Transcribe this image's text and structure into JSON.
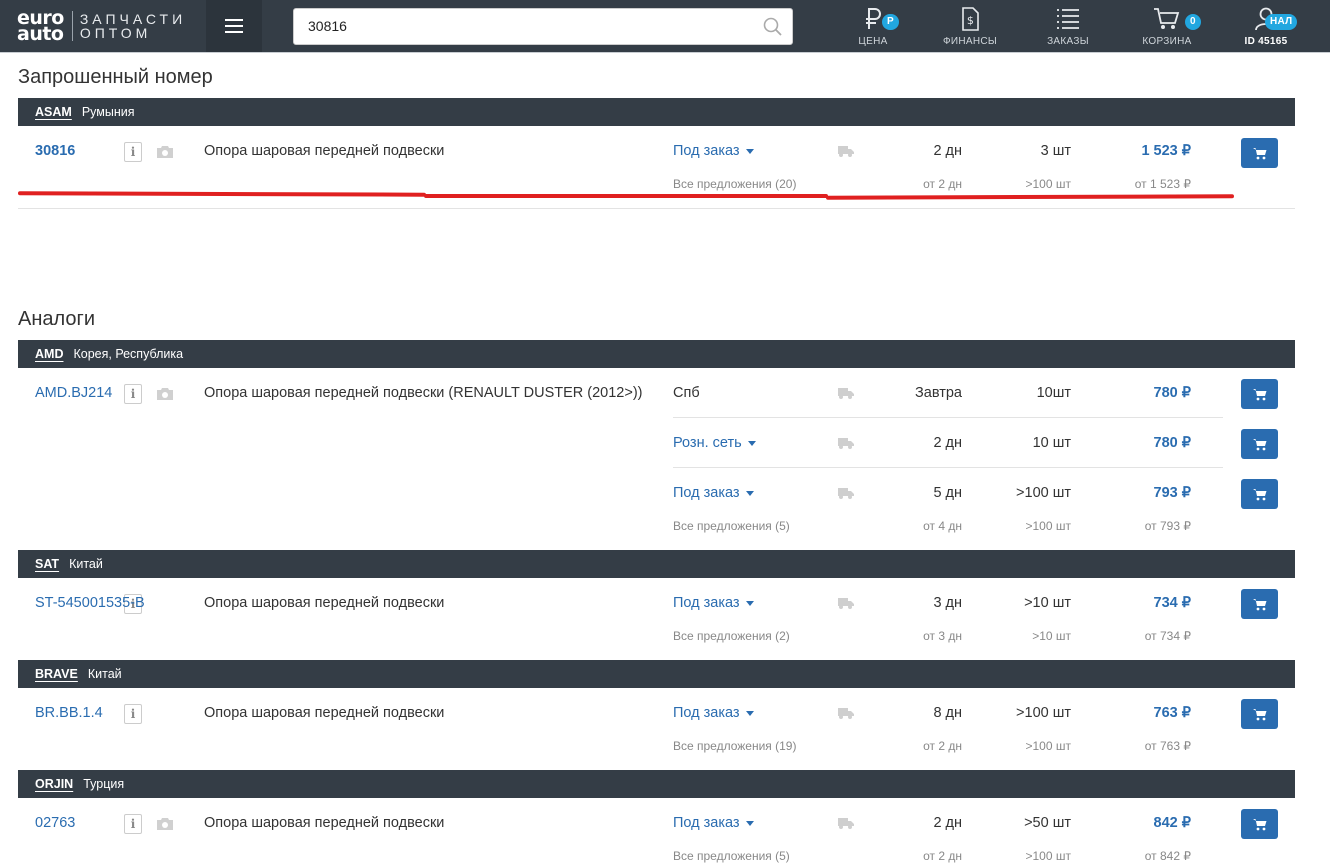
{
  "header": {
    "logo_line1": "euro",
    "logo_line2": "auto",
    "logo_text1": "ЗАПЧАСТИ",
    "logo_text2": "ОПТОМ",
    "search_value": "30816",
    "nav": [
      {
        "label": "ЦЕНА",
        "icon": "ruble-icon",
        "badge": "Р"
      },
      {
        "label": "ФИНАНСЫ",
        "icon": "document-dollar-icon"
      },
      {
        "label": "ЗАКАЗЫ",
        "icon": "list-icon"
      },
      {
        "label": "КОРЗИНА",
        "icon": "cart-icon",
        "badge": "0"
      },
      {
        "label": "ID 45165",
        "icon": "user-icon",
        "badge": "НАЛ"
      }
    ]
  },
  "requested": {
    "title": "Запрошенный номер",
    "brand": "ASAM",
    "country": "Румыния",
    "item": {
      "number": "30816",
      "description": "Опора шаровая передней подвески",
      "availability": "Под заказ",
      "days": "2 дн",
      "qty": "3 шт",
      "price": "1 523 ₽",
      "all_offers": "Все предложения (20)",
      "min_days": "от 2 дн",
      "max_qty": ">100 шт",
      "min_price": "от 1 523 ₽"
    }
  },
  "analogs": {
    "title": "Аналоги",
    "groups": [
      {
        "brand": "AMD",
        "country": "Корея, Республика",
        "number": "AMD.BJ214",
        "description": "Опора шаровая передней подвески (RENAULT DUSTER (2012>))",
        "offers": [
          {
            "availability": "Спб",
            "days": "Завтра",
            "qty": "10шт",
            "price": "780 ₽"
          },
          {
            "availability": "Розн. сеть",
            "days": "2 дн",
            "qty": "10 шт",
            "price": "780 ₽"
          },
          {
            "availability": "Под заказ",
            "days": "5 дн",
            "qty": ">100 шт",
            "price": "793 ₽"
          }
        ],
        "all_offers": "Все предложения (5)",
        "min_days": "от 4 дн",
        "max_qty": ">100 шт",
        "min_price": "от 793 ₽"
      },
      {
        "brand": "SAT",
        "country": "Китай",
        "number": "ST-545001535-B",
        "description": "Опора шаровая передней подвески",
        "offers": [
          {
            "availability": "Под заказ",
            "days": "3 дн",
            "qty": ">10 шт",
            "price": "734 ₽"
          }
        ],
        "all_offers": "Все предложения (2)",
        "min_days": "от 3 дн",
        "max_qty": ">10 шт",
        "min_price": "от 734 ₽"
      },
      {
        "brand": "BRAVE",
        "country": "Китай",
        "number": "BR.BB.1.4",
        "description": "Опора шаровая передней подвески",
        "offers": [
          {
            "availability": "Под заказ",
            "days": "8 дн",
            "qty": ">100 шт",
            "price": "763 ₽"
          }
        ],
        "all_offers": "Все предложения (19)",
        "min_days": "от 2 дн",
        "max_qty": ">100 шт",
        "min_price": "от 763 ₽"
      },
      {
        "brand": "ORJIN",
        "country": "Турция",
        "number": "02763",
        "description": "Опора шаровая передней подвески",
        "offers": [
          {
            "availability": "Под заказ",
            "days": "2 дн",
            "qty": ">50 шт",
            "price": "842 ₽"
          }
        ],
        "all_offers": "Все предложения (5)",
        "min_days": "от 2 дн",
        "max_qty": ">100 шт",
        "min_price": "от 842 ₽"
      }
    ]
  },
  "colors": {
    "topbar": "#343d46",
    "accent": "#2a6cb0",
    "badge": "#22a7e0",
    "annotation": "#e02020"
  }
}
